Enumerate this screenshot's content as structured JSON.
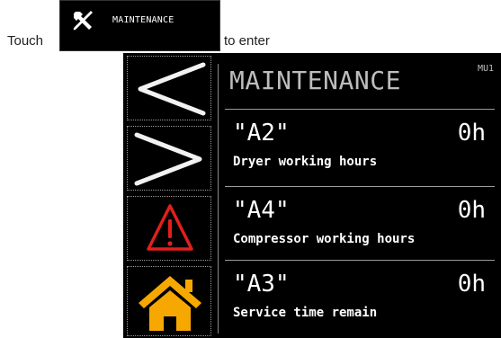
{
  "instruction": {
    "before": "Touch",
    "after": "to enter",
    "key_label": "MAINTENANCE",
    "key_icon": "wrench-screwdriver-icon"
  },
  "screen": {
    "title": "MAINTENANCE",
    "page_code": "MU1",
    "nav": [
      {
        "name": "back",
        "icon": "chevron-left-icon"
      },
      {
        "name": "forward",
        "icon": "chevron-right-icon"
      },
      {
        "name": "alarm",
        "icon": "warning-triangle-icon"
      },
      {
        "name": "home",
        "icon": "home-icon"
      }
    ],
    "items": [
      {
        "code": "\"A2\"",
        "value": "0h",
        "label": "Dryer working hours"
      },
      {
        "code": "\"A4\"",
        "value": "0h",
        "label": "Compressor working hours"
      },
      {
        "code": "\"A3\"",
        "value": "0h",
        "label": "Service time remain"
      }
    ]
  },
  "colors": {
    "panel_bg": "#000000",
    "text": "#ffffff",
    "title_text": "#bdbdbd",
    "alarm_red": "#e0201c",
    "home_orange": "#f7a800"
  }
}
